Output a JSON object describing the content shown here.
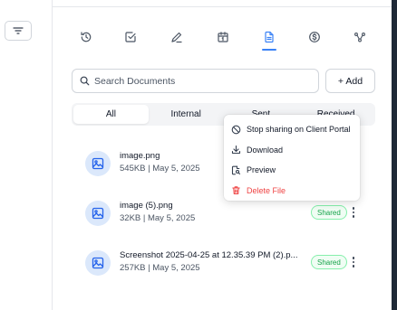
{
  "search": {
    "placeholder": "Search Documents"
  },
  "add_button": {
    "label": "+ Add"
  },
  "tabs": [
    "history-icon",
    "check-square-icon",
    "pen-icon",
    "calendar-icon",
    "document-icon",
    "dollar-icon",
    "share-nodes-icon"
  ],
  "segments": [
    {
      "label": "All",
      "active": true
    },
    {
      "label": "Internal",
      "active": false
    },
    {
      "label": "Sent",
      "active": false
    },
    {
      "label": "Received",
      "active": false
    }
  ],
  "documents": [
    {
      "name": "image.png",
      "meta": "545KB | May 5, 2025",
      "badge": ""
    },
    {
      "name": "image (5).png",
      "meta": "32KB | May 5, 2025",
      "badge": "Shared"
    },
    {
      "name": "Screenshot 2025-04-25 at 12.35.39 PM (2).p...",
      "meta": "257KB | May 5, 2025",
      "badge": "Shared"
    }
  ],
  "context_menu": {
    "items": [
      {
        "label": "Stop sharing on Client Portal",
        "icon": "block-icon"
      },
      {
        "label": "Download",
        "icon": "download-icon"
      },
      {
        "label": "Preview",
        "icon": "preview-icon"
      },
      {
        "label": "Delete File",
        "icon": "trash-icon",
        "danger": true
      }
    ]
  },
  "colors": {
    "accent": "#3b82f6",
    "shared_badge": "#16a34a",
    "danger": "#ef4444",
    "doc_icon_bg": "#dbe8fb"
  }
}
